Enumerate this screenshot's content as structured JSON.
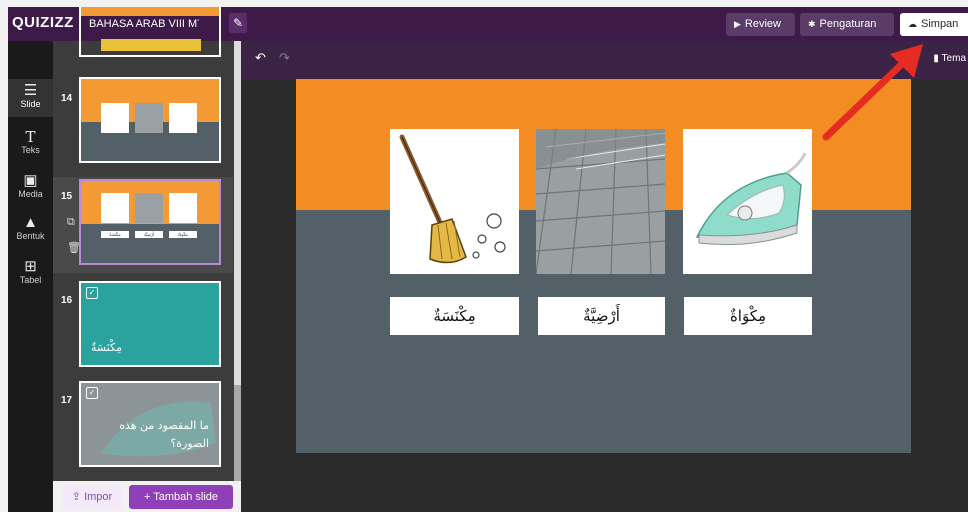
{
  "app": {
    "logo": "QUIZIZZ",
    "title": "BAHASA ARAB VIII MTSN K"
  },
  "topbar": {
    "review_label": "Review",
    "settings_label": "Pengaturan",
    "save_label": "Simpan"
  },
  "toolbar": {
    "theme_label": "Tema"
  },
  "rail": {
    "items": [
      {
        "label": "Slide",
        "icon": "slides-icon"
      },
      {
        "label": "Teks",
        "icon": "text-icon"
      },
      {
        "label": "Media",
        "icon": "media-icon"
      },
      {
        "label": "Bentuk",
        "icon": "shapes-icon"
      },
      {
        "label": "Tabel",
        "icon": "table-icon"
      }
    ]
  },
  "slides": [
    {
      "number": "14"
    },
    {
      "number": "15"
    },
    {
      "number": "16",
      "text": "مِكْنَسَةٌ"
    },
    {
      "number": "17",
      "text": "ما المقصود من هذه الصورة؟"
    }
  ],
  "slide_panel": {
    "import_label": "Impor",
    "add_slide_label": "+ Tambah slide"
  },
  "canvas": {
    "words": [
      "مِكْنَسَةٌ",
      "أَرْضِيَّةٌ",
      "مِكْوَاةٌ"
    ]
  },
  "colors": {
    "topbar": "#3d1a48",
    "orange": "#f38c23",
    "slate": "#536068",
    "teal": "#2aa39f",
    "accent_purple": "#8f3fb8"
  }
}
